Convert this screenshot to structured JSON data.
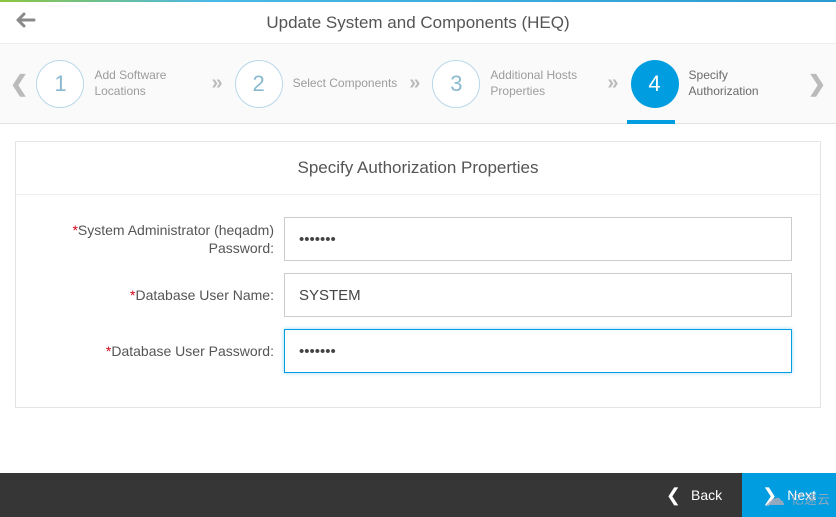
{
  "header": {
    "title": "Update System and Components (HEQ)"
  },
  "wizard": {
    "steps": [
      {
        "num": "1",
        "label": "Add Software Locations"
      },
      {
        "num": "2",
        "label": "Select Components"
      },
      {
        "num": "3",
        "label": "Additional Hosts Properties"
      },
      {
        "num": "4",
        "label": "Specify Authorization"
      }
    ]
  },
  "panel": {
    "title": "Specify Authorization Properties",
    "fields": {
      "admin_pw_label": "System Administrator (heqadm) Password:",
      "admin_pw_value": "•••••••",
      "db_user_label": "Database User Name:",
      "db_user_value": "SYSTEM",
      "db_pw_label": "Database User Password:",
      "db_pw_value": "•••••••"
    }
  },
  "buttons": {
    "back": "Back",
    "next": "Next"
  },
  "watermark": "亿速云"
}
